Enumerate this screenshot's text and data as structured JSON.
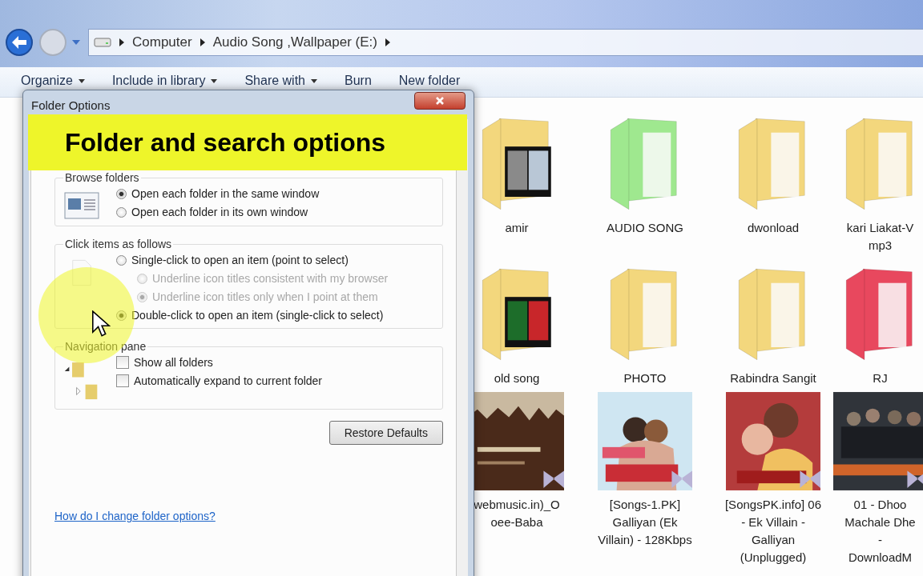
{
  "address_bar": {
    "crumbs": [
      "Computer",
      "Audio Song ,Wallpaper (E:)"
    ]
  },
  "toolbar": [
    {
      "label": "Organize",
      "dropdown": true
    },
    {
      "label": "Include in library",
      "dropdown": true
    },
    {
      "label": "Share with",
      "dropdown": true
    },
    {
      "label": "Burn",
      "dropdown": false
    },
    {
      "label": "New folder",
      "dropdown": false
    }
  ],
  "files": [
    {
      "kind": "photo-folder",
      "color": "#f3d77d",
      "lines": [
        "amir"
      ]
    },
    {
      "kind": "folder",
      "color": "#9fe88f",
      "lines": [
        "AUDIO SONG"
      ]
    },
    {
      "kind": "folder",
      "color": "#f3d77d",
      "lines": [
        "dwonload"
      ]
    },
    {
      "kind": "folder",
      "color": "#f3d77d",
      "lines": [
        "kari Liakat-V",
        "mp3"
      ]
    },
    {
      "kind": "photo-folder",
      "color": "#f3d77d",
      "lines": [
        "old song"
      ]
    },
    {
      "kind": "folder",
      "color": "#f3d77d",
      "lines": [
        "PHOTO"
      ]
    },
    {
      "kind": "folder",
      "color": "#f3d77d",
      "lines": [
        "Rabindra Sangit"
      ]
    },
    {
      "kind": "folder",
      "color": "#e8485e",
      "lines": [
        "RJ"
      ]
    },
    {
      "kind": "video",
      "lines": [
        "webmusic.in)_O",
        "oee-Baba"
      ]
    },
    {
      "kind": "video",
      "lines": [
        "[Songs-1.PK]",
        "Galliyan (Ek",
        "Villain) - 128Kbps"
      ]
    },
    {
      "kind": "video",
      "lines": [
        "[SongsPK.info] 06",
        "- Ek Villain -",
        "Galliyan",
        "(Unplugged)"
      ]
    },
    {
      "kind": "video",
      "lines": [
        "01 - Dhoo",
        "Machale Dhe",
        "-",
        "DownloadM"
      ]
    }
  ],
  "dialog": {
    "title": "Folder Options",
    "groups": [
      {
        "label": "Browse folders",
        "kind": "radios",
        "options": [
          {
            "label": "Open each folder in the same window",
            "selected": true,
            "disabled": false
          },
          {
            "label": "Open each folder in its own window",
            "selected": false,
            "disabled": false
          }
        ]
      },
      {
        "label": "Click items as follows",
        "kind": "radios",
        "options": [
          {
            "label": "Single-click to open an item (point to select)",
            "selected": false,
            "disabled": false,
            "children": [
              {
                "label": "Underline icon titles consistent with my browser",
                "selected": false,
                "disabled": true
              },
              {
                "label": "Underline icon titles only when I point at them",
                "selected": true,
                "disabled": true
              }
            ]
          },
          {
            "label": "Double-click to open an item (single-click to select)",
            "selected": true,
            "disabled": false
          }
        ]
      },
      {
        "label": "Navigation pane",
        "kind": "checks",
        "options": [
          {
            "label": "Show all folders",
            "checked": false
          },
          {
            "label": "Automatically expand to current folder",
            "checked": false
          }
        ]
      }
    ],
    "restore_button": "Restore Defaults",
    "help_link": "How do I change folder options?"
  },
  "callout": {
    "text": "Folder and search options"
  }
}
